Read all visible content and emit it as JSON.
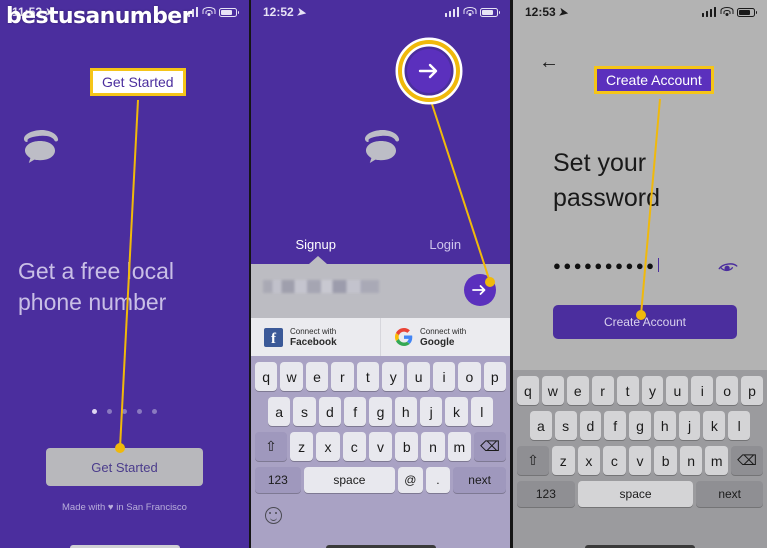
{
  "watermark": "bestusanumber",
  "annotations": {
    "get_started": "Get Started",
    "create_account": "Create Account"
  },
  "panel1": {
    "status": {
      "time": "11:52"
    },
    "logo_name": "speech-bubble-phone-logo",
    "headline": "Get a free local\nphone number",
    "page_dots_count": 5,
    "page_dot_active_index": 0,
    "cta_label": "Get Started",
    "footer": "Made with ♥ in San Francisco"
  },
  "panel2": {
    "status": {
      "time": "12:52"
    },
    "arrow_button_name": "forward-arrow-button",
    "logo_name": "speech-bubble-phone-logo",
    "tabs": [
      {
        "label": "Signup",
        "active": true
      },
      {
        "label": "Login",
        "active": false
      }
    ],
    "input_value": "",
    "input_redacted": true,
    "submit_arrow_label": "→",
    "social": [
      {
        "icon": "facebook-icon",
        "small": "Connect with",
        "big": "Facebook"
      },
      {
        "icon": "google-icon",
        "small": "Connect with",
        "big": "Google"
      }
    ],
    "keyboard": {
      "row1": [
        "q",
        "w",
        "e",
        "r",
        "t",
        "y",
        "u",
        "i",
        "o",
        "p"
      ],
      "row2": [
        "a",
        "s",
        "d",
        "f",
        "g",
        "h",
        "j",
        "k",
        "l"
      ],
      "row3": [
        "z",
        "x",
        "c",
        "v",
        "b",
        "n",
        "m"
      ],
      "shift": "⇧",
      "backspace": "⌫",
      "num": "123",
      "space": "space",
      "at": "@",
      "dot": ".",
      "next": "next",
      "emoji": "emoji-icon"
    }
  },
  "panel3": {
    "status": {
      "time": "12:53"
    },
    "back_label": "←",
    "title": "Set your\npassword",
    "password_masked": "●●●●●●●●●●",
    "eye_icon": "eye-toggle-icon",
    "cta_label": "Create Account",
    "keyboard": {
      "row1": [
        "q",
        "w",
        "e",
        "r",
        "t",
        "y",
        "u",
        "i",
        "o",
        "p"
      ],
      "row2": [
        "a",
        "s",
        "d",
        "f",
        "g",
        "h",
        "j",
        "k",
        "l"
      ],
      "row3": [
        "z",
        "x",
        "c",
        "v",
        "b",
        "n",
        "m"
      ],
      "shift": "⇧",
      "backspace": "⌫",
      "num": "123",
      "space": "space",
      "next": "next"
    }
  },
  "colors": {
    "brand_purple": "#4b2e9e",
    "accent_purple": "#5b30bd",
    "annotation_yellow": "#f5c518",
    "panel3_bg": "#b3b3b3"
  }
}
